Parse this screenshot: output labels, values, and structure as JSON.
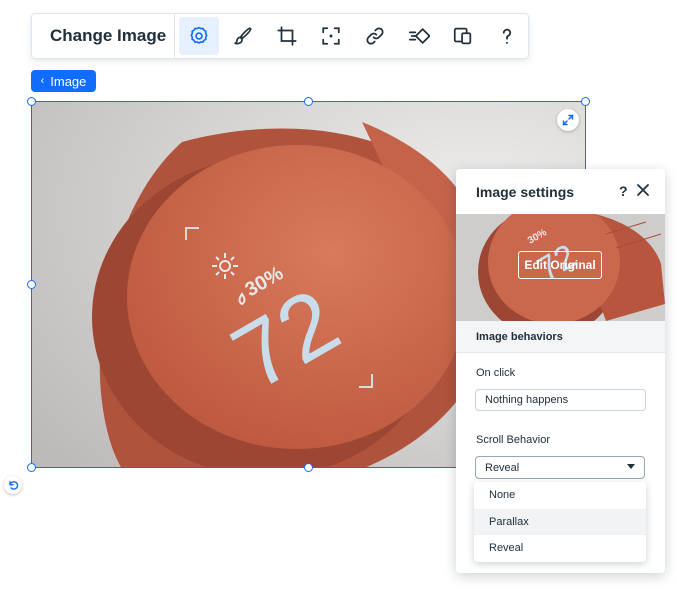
{
  "toolbar": {
    "title": "Change Image",
    "buttons": [
      {
        "name": "settings",
        "icon": "gear-icon",
        "active": true
      },
      {
        "name": "design",
        "icon": "brush-icon"
      },
      {
        "name": "crop",
        "icon": "crop-icon"
      },
      {
        "name": "focal-point",
        "icon": "focus-icon"
      },
      {
        "name": "link",
        "icon": "link-icon"
      },
      {
        "name": "animation",
        "icon": "animation-icon"
      },
      {
        "name": "stretch",
        "icon": "layout-icon"
      },
      {
        "name": "help",
        "icon": "help-icon"
      }
    ]
  },
  "element_tag": {
    "label": "Image",
    "icon": "chevron-left-icon"
  },
  "photo": {
    "humidity": "30%",
    "temperature": "72",
    "dial_color": "#cf6a4e",
    "background_color": "#d9d7d6"
  },
  "panel": {
    "title": "Image settings",
    "help": "?",
    "edit_button": "Edit Original",
    "section_title": "Image behaviors",
    "on_click": {
      "label": "On click",
      "value": "Nothing happens"
    },
    "scroll_behavior": {
      "label": "Scroll Behavior",
      "value": "Reveal",
      "options": [
        "None",
        "Parallax",
        "Reveal"
      ],
      "highlighted": "Parallax"
    }
  },
  "colors": {
    "accent": "#116dff",
    "text": "#20303c"
  }
}
